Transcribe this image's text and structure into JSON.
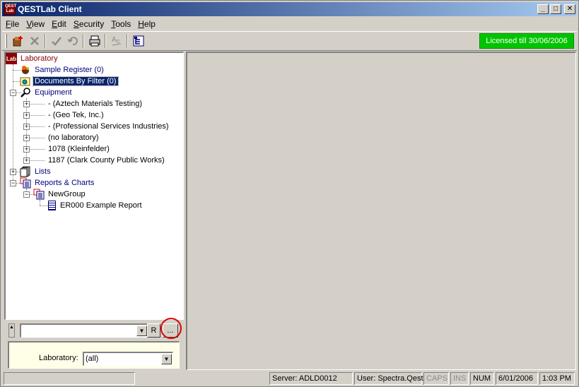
{
  "window": {
    "title": "QESTLab Client",
    "app_icon_text": "QEST Lab"
  },
  "window_controls": {
    "minimize": "_",
    "maximize": "□",
    "close": "✕"
  },
  "menu": [
    {
      "label": "File",
      "mnemonic": "F",
      "rest": "ile"
    },
    {
      "label": "View",
      "mnemonic": "V",
      "rest": "iew"
    },
    {
      "label": "Edit",
      "mnemonic": "E",
      "rest": "dit"
    },
    {
      "label": "Security",
      "mnemonic": "S",
      "rest": "ecurity"
    },
    {
      "label": "Tools",
      "mnemonic": "T",
      "rest": "ools"
    },
    {
      "label": "Help",
      "mnemonic": "H",
      "rest": "elp"
    }
  ],
  "toolbar": {
    "license": "Licensed till 30/06/2006",
    "license_color": "#00c400",
    "icons": [
      "new-record-icon",
      "delete-icon",
      "check-icon",
      "undo-icon",
      "print-icon",
      "spell-check-icon",
      "tree-view-icon"
    ]
  },
  "tree": {
    "root": {
      "label": "Laboratory",
      "icon_text": "Lab"
    },
    "items": [
      {
        "label": "Sample Register (0)"
      },
      {
        "label": "Documents By Filter (0)",
        "selected": true
      },
      {
        "label": "Equipment"
      },
      {
        "label": "- (Aztech Materials Testing)"
      },
      {
        "label": "- (Geo Tek, Inc.)"
      },
      {
        "label": "- (Professional Services Industries)"
      },
      {
        "label": "(no laboratory)"
      },
      {
        "label": "1078 (Kleinfelder)"
      },
      {
        "label": "1187 (Clark County Public Works)"
      },
      {
        "label": "Lists"
      },
      {
        "label": "Reports & Charts"
      },
      {
        "label": "NewGroup"
      },
      {
        "label": "ER000 Example Report"
      }
    ]
  },
  "lower": {
    "combo_value": "",
    "r_button": "R",
    "browse_button": "...",
    "filter_label": "Laboratory:",
    "filter_value": "(all)"
  },
  "status": {
    "server": "Server: ADLD0012",
    "user": "User: Spectra.Qest",
    "caps": "CAPS",
    "ins": "INS",
    "num": "NUM",
    "date": "6/01/2006",
    "time": "1:03 PM"
  }
}
